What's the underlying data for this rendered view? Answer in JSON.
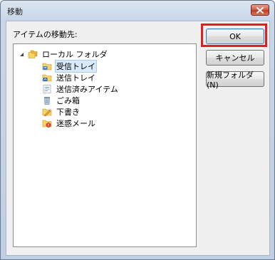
{
  "window": {
    "title": "移動"
  },
  "dialog": {
    "prompt_label": "アイテムの移動先:"
  },
  "tree": {
    "root": {
      "label": "ローカル フォルダ",
      "icon": "folder-pair-icon"
    },
    "items": [
      {
        "label": "受信トレイ",
        "icon": "inbox-icon",
        "selected": true
      },
      {
        "label": "送信トレイ",
        "icon": "outbox-icon",
        "selected": false
      },
      {
        "label": "送信済みアイテム",
        "icon": "sent-items-icon",
        "selected": false
      },
      {
        "label": "ごみ箱",
        "icon": "trash-icon",
        "selected": false
      },
      {
        "label": "下書き",
        "icon": "drafts-icon",
        "selected": false
      },
      {
        "label": "迷惑メール",
        "icon": "junk-mail-icon",
        "selected": false
      }
    ]
  },
  "buttons": {
    "ok": "OK",
    "cancel": "キャンセル",
    "new_folder": "新規フォルダ(N)"
  },
  "colors": {
    "highlight": "#e02020",
    "selection": "#d9ebfa",
    "folder": "#f2c94c"
  }
}
